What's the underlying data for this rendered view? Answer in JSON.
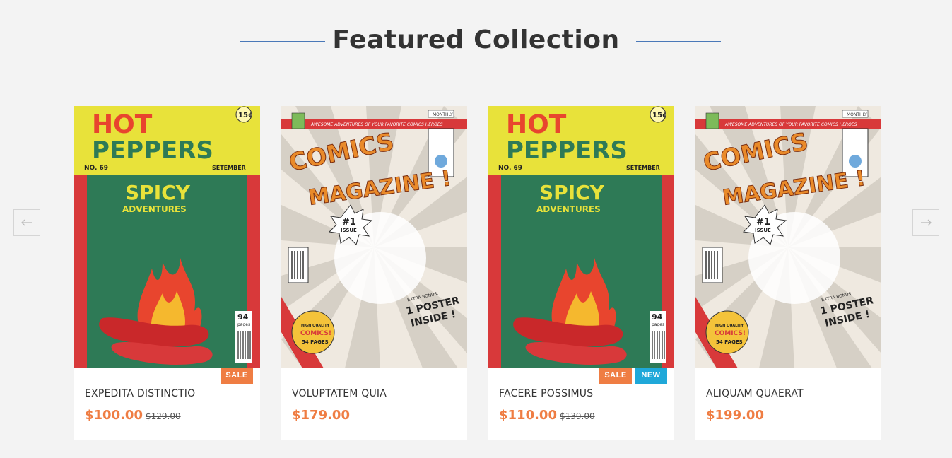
{
  "section": {
    "title": "Featured Collection"
  },
  "nav": {
    "prev_icon": "arrow-left-icon",
    "next_icon": "arrow-right-icon"
  },
  "colors": {
    "accent": "#ef7d43",
    "new_badge": "#1fa8d9",
    "title_line": "#4a78b8"
  },
  "products": [
    {
      "name": "EXPEDITA DISTINCTIO",
      "price": "$100.00",
      "old_price": "$129.00",
      "badges": [
        "SALE"
      ],
      "cover": "hot-peppers",
      "cover_text": {
        "title1": "HOT",
        "title2": "PEPPERS",
        "price_tag": "15¢",
        "issue": "NO. 69",
        "month": "SETEMBER",
        "sub1": "SPICY",
        "sub2": "ADVENTURES",
        "pages_num": "94",
        "pages_label": "pages"
      }
    },
    {
      "name": "VOLUPTATEM QUIA",
      "price": "$179.00",
      "old_price": "",
      "badges": [],
      "cover": "comics-magazine",
      "cover_text": {
        "banner": "AWESOME ADVENTURES OF YOUR FAVORITE COMICS HEROES",
        "freq": "MONTHLY",
        "title1": "COMICS",
        "title2": "MAGAZINE !",
        "num": "#1",
        "issue": "ISSUE",
        "bonus1": "EXTRA BONUS:",
        "bonus2": "1 POSTER",
        "bonus3": "INSIDE !",
        "seal1": "HIGH QUALITY",
        "seal2": "COMICS!",
        "seal3": "54 PAGES"
      }
    },
    {
      "name": "FACERE POSSIMUS",
      "price": "$110.00",
      "old_price": "$139.00",
      "badges": [
        "SALE",
        "NEW"
      ],
      "cover": "hot-peppers",
      "cover_text": {
        "title1": "HOT",
        "title2": "PEPPERS",
        "price_tag": "15¢",
        "issue": "NO. 69",
        "month": "SETEMBER",
        "sub1": "SPICY",
        "sub2": "ADVENTURES",
        "pages_num": "94",
        "pages_label": "pages"
      }
    },
    {
      "name": "ALIQUAM QUAERAT",
      "price": "$199.00",
      "old_price": "",
      "badges": [],
      "cover": "comics-magazine",
      "cover_text": {
        "banner": "AWESOME ADVENTURES OF YOUR FAVORITE COMICS HEROES",
        "freq": "MONTHLY",
        "title1": "COMICS",
        "title2": "MAGAZINE !",
        "num": "#1",
        "issue": "ISSUE",
        "bonus1": "EXTRA BONUS:",
        "bonus2": "1 POSTER",
        "bonus3": "INSIDE !",
        "seal1": "HIGH QUALITY",
        "seal2": "COMICS!",
        "seal3": "54 PAGES"
      }
    }
  ]
}
